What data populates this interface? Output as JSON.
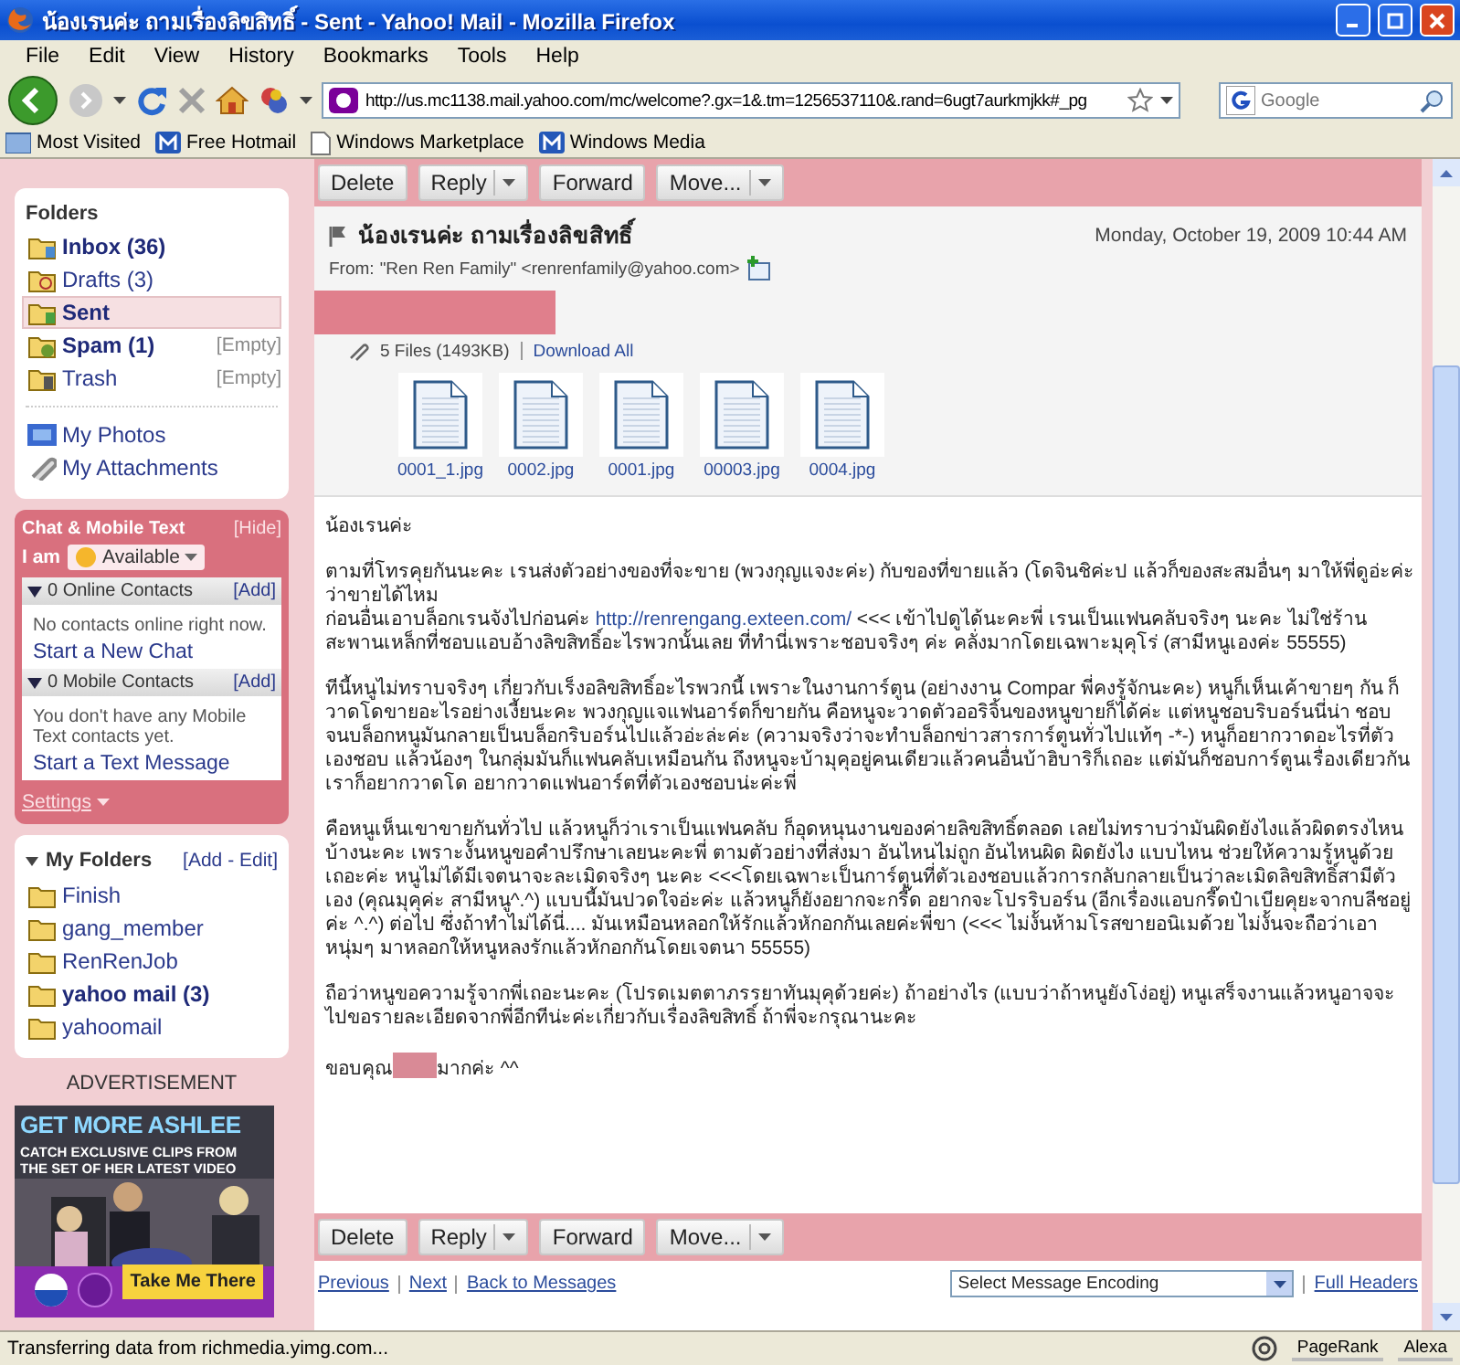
{
  "window": {
    "title": "น้องเรนค่ะ ถามเรื่องลิขสิทธิ์ - Sent - Yahoo! Mail - Mozilla Firefox"
  },
  "menu": [
    "File",
    "Edit",
    "View",
    "History",
    "Bookmarks",
    "Tools",
    "Help"
  ],
  "address_bar": {
    "value": "http://us.mc1138.mail.yahoo.com/mc/welcome?.gx=1&.tm=1256537110&.rand=6ugt7aurkmjkk#_pg"
  },
  "search": {
    "placeholder": "Google"
  },
  "bookmarks": [
    "Most Visited",
    "Free Hotmail",
    "Windows Marketplace",
    "Windows Media"
  ],
  "sidebar": {
    "folders_heading": "Folders",
    "folders": [
      {
        "label": "Inbox (36)",
        "unread": true,
        "selected": false
      },
      {
        "label": "Drafts (3)",
        "unread": false,
        "selected": false
      },
      {
        "label": "Sent",
        "unread": true,
        "selected": true
      },
      {
        "label": "Spam (1)",
        "unread": true,
        "selected": false,
        "action": "[Empty]"
      },
      {
        "label": "Trash",
        "unread": false,
        "selected": false,
        "action": "[Empty]"
      }
    ],
    "links": [
      "My Photos",
      "My Attachments"
    ],
    "chat": {
      "title": "Chat & Mobile Text",
      "hide": "[Hide]",
      "status_label": "I am",
      "status": "Available",
      "sections": [
        {
          "heading": "0 Online Contacts",
          "add": "[Add]",
          "message": "No contacts online right now.",
          "link": "Start a New Chat"
        },
        {
          "heading": "0 Mobile Contacts",
          "add": "[Add]",
          "message": "You don't have any Mobile Text contacts yet.",
          "link": "Start a Text Message"
        }
      ],
      "settings": "Settings"
    },
    "my_folders": {
      "heading": "My Folders",
      "actions": "[Add - Edit]",
      "folders": [
        {
          "label": "Finish",
          "unread": false
        },
        {
          "label": "gang_member",
          "unread": false
        },
        {
          "label": "RenRenJob",
          "unread": false
        },
        {
          "label": "yahoo mail (3)",
          "unread": true
        },
        {
          "label": "yahoomail",
          "unread": false
        }
      ]
    },
    "advertisement": {
      "label": "ADVERTISEMENT",
      "headline": "GET MORE ASHLEE",
      "tagline": "CATCH EXCLUSIVE CLIPS FROM THE SET OF HER LATEST VIDEO",
      "button": "Take Me There"
    }
  },
  "message": {
    "top_toolbar": [
      {
        "label": "Delete",
        "has_menu": false
      },
      {
        "label": "Reply",
        "has_menu": true
      },
      {
        "label": "Forward",
        "has_menu": false
      },
      {
        "label": "Move...",
        "has_menu": true
      }
    ],
    "subject": "น้องเรนค่ะ ถามเรื่องลิขสิทธิ์",
    "date": "Monday, October 19, 2009 10:44 AM",
    "from_label": "From:",
    "from": "\"Ren Ren Family\" <renrenfamily@yahoo.com>",
    "attachments_summary": "5 Files (1493KB)",
    "download_all": "Download All",
    "attachments": [
      "0001_1.jpg",
      "0002.jpg",
      "0001.jpg",
      "00003.jpg",
      "0004.jpg"
    ],
    "body": [
      {
        "lines": [
          {
            "kind": "text",
            "text": "น้องเรนค่ะ"
          }
        ]
      },
      {
        "lines": [
          {
            "kind": "text",
            "text": "ตามที่โทรคุยกันนะคะ เรนส่งตัวอย่างของที่จะขาย (พวงกุญแจงะค่ะ) กับของที่ขายแล้ว (โดจินชิค่ะป แล้วก็ของสะสมอื่นๆ มาให้พี่ดูอ่ะค่ะว่าขายได้ไหม"
          },
          {
            "kind": "link",
            "before": "ก่อนอื่นเอาบล็อกเรนจังไปก่อนค่ะ ",
            "link": "http://renrengang.exteen.com/",
            "after": "  <<< เข้าไปดูได้นะคะพี่ เรนเป็นแฟนคลับจริงๆ นะคะ ไม่ใช่ร้านสะพานเหล็กที่ชอบแอบอ้างลิขสิทธิ์อะไรพวกนั้นเลย  ที่ทำนี่เพราะชอบจริงๆ ค่ะ คลั่งมากโดยเฉพาะมุคุโร่ (สามีหนูเองค่ะ 55555)"
          }
        ]
      },
      {
        "lines": [
          {
            "kind": "text",
            "text": "ทีนี้หนูไม่ทราบจริงๆ เกี่ยวกับเร็งอลิขสิทธิ์อะไรพวกนี้ เพราะในงานการ์ตูน (อย่างงาน Compar พี่คงรู้จักนะคะ) หนูก็เห็นเค้าขายๆ กัน  ก็วาดโดขายอะไรอย่างเงี้ยนะคะ  พวงกุญแจแฟนอาร์ตก็ขายกัน  คือหนูจะวาดตัวออริจิ้นของหนูขายก็ได้ค่ะ  แต่หนูชอบริบอร์นนี่น่า  ชอบจนบล็อกหนูมันกลายเป็นบล็อกริบอร์นไปแล้วอ่ะล่ะค่ะ (ความจริงว่าจะทำบล็อกข่าวสารการ์ตูนทั่วไปแท้ๆ -*-)  หนูก็อยากวาดอะไรที่ตัวเองชอบ  แล้วน้องๆ ในกลุ่มมันก็แฟนคลับเหมือนกัน ถึงหนูจะบ้ามุคุอยู่คนเดียวแล้วคนอื่นบ้าฮิบาริก็เถอะ  แต่มันก็ชอบการ์ตูนเรื่องเดียวกัน เราก็อยากวาดโด อยากวาดแฟนอาร์ตที่ตัวเองชอบน่ะค่ะพี่"
          }
        ]
      },
      {
        "lines": [
          {
            "kind": "text",
            "text": "คือหนูเห็นเขาขายกันทั่วไป แล้วหนูก็ว่าเราเป็นแฟนคลับ ก็อุดหนุนงานของค่ายลิขสิทธิ์ตลอด เลยไม่ทราบว่ามันผิดยังไงแล้วผิดตรงไหนบ้างนะคะ  เพราะงั้นหนูขอคำปรึกษาเลยนะคะพี่ ตามตัวอย่างที่ส่งมา อันไหนไม่ถูก อันไหนผิด ผิดยังไง แบบไหน ช่วยให้ความรู้หนูด้วยเถอะค่ะ หนูไม่ได้มีเจตนาจะละเมิดจริงๆ นะคะ <<<โดยเฉพาะเป็นการ์ตูนที่ตัวเองชอบแล้วการกลับกลายเป็นว่าละเมิดลิขสิทธิ์สามีตัวเอง (คุณมุคุค่ะ สามีหนู^.^) แบบนี้มันปวดใจอ่ะค่ะ  แล้วหนูก็ยังอยากจะกรี๊ด อยากจะโปรริบอร์น (อีกเรื่องแอบกรี๊ดป๋าเบียคุยะจากบลีชอยู่ค่ะ ^.^) ต่อไป  ซึ่งถ้าทำไม่ได้นี่.... มันเหมือนหลอกให้รักแล้วหักอกกันเลยค่ะพี่ขา (<<< ไม่งั้นห้ามโรสขายอนิเมด้วย ไม่งั้นจะถือว่าเอาหนุ่มๆ มาหลอกให้หนูหลงรักแล้วหักอกกันโดยเจตนา 55555)"
          }
        ]
      },
      {
        "lines": [
          {
            "kind": "text",
            "text": "ถือว่าหนูขอความรู้จากพี่เถอะนะคะ (โปรดเมตตาภรรยาทันมุคุด้วยค่ะ)  ถ้าอย่างไร (แบบว่าถ้าหนูยังโง่อยู่) หนูเสร็จงานแล้วหนูอาจจะไปขอรายละเอียดจากพี่อีกทีน่ะค่ะเกี่ยวกับเรื่องลิขสิทธิ์ ถ้าพี่จะกรุณานะคะ"
          }
        ]
      },
      {
        "lines": [
          {
            "kind": "redacted",
            "before": "ขอบคุณ",
            "after": "มากค่ะ ^^"
          }
        ]
      }
    ],
    "bottom_toolbar": [
      {
        "label": "Delete",
        "has_menu": false
      },
      {
        "label": "Reply",
        "has_menu": true
      },
      {
        "label": "Forward",
        "has_menu": false
      },
      {
        "label": "Move...",
        "has_menu": true
      }
    ],
    "footer_links": [
      "Previous",
      "Next",
      "Back to Messages"
    ],
    "encoding": {
      "value": "Select Message Encoding"
    },
    "full_headers": "Full Headers"
  },
  "status_bar": {
    "text": "Transferring data from richmedia.yimg.com...",
    "items": [
      "PageRank",
      "Alexa"
    ]
  }
}
